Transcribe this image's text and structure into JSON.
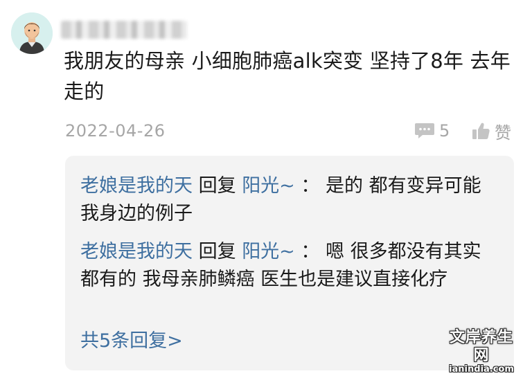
{
  "comment": {
    "author_avatar": "man-avatar-icon",
    "author_name_blurred": true,
    "text": "我朋友的母亲 小细胞肺癌alk突变 坚持了8年 去年走的",
    "date": "2022-04-26",
    "reply_count": "5",
    "like_label": "赞",
    "icons": {
      "reply": "comment-bubble-icon",
      "like": "thumbs-up-icon"
    }
  },
  "replies": [
    {
      "user": "老娘是我的天",
      "action": "回复",
      "target": "阳光~",
      "separator": "：",
      "text": "是的 都有变异可能 我身边的例子"
    },
    {
      "user": "老娘是我的天",
      "action": "回复",
      "target": "阳光~",
      "separator": "：",
      "text": "嗯 很多都没有其实都有的 我母亲肺鳞癌 医生也是建议直接化疗"
    }
  ],
  "more_replies": "共5条回复>",
  "watermark": {
    "top": "文岸养生网",
    "bottom": "ianindia.com"
  },
  "colors": {
    "link": "#3e6fa0",
    "muted": "#a6a6a6",
    "reply_bg": "#f3f3f3",
    "avatar_bg": "#d7f0ee"
  }
}
